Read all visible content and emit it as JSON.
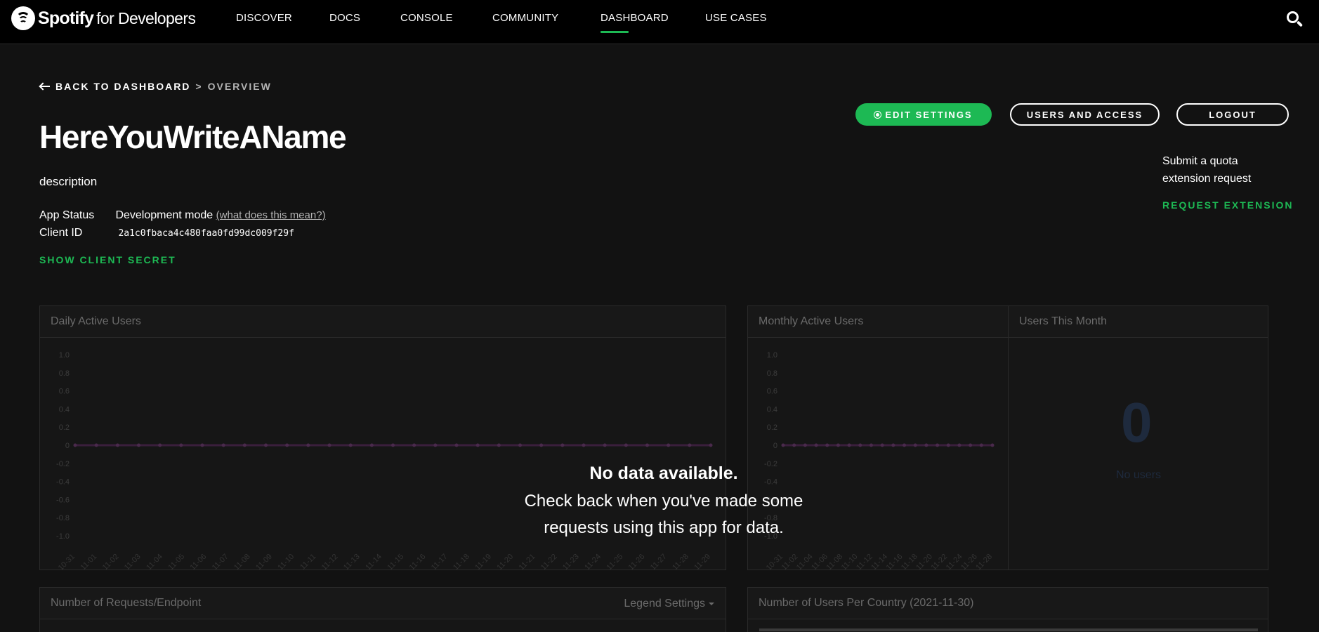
{
  "nav": {
    "brand_name": "Spotify",
    "brand_suffix": "for Developers",
    "links": [
      "DISCOVER",
      "DOCS",
      "CONSOLE",
      "COMMUNITY",
      "DASHBOARD",
      "USE CASES"
    ],
    "active": "DASHBOARD"
  },
  "breadcrumb": {
    "back": "BACK TO DASHBOARD",
    "separator": ">",
    "current": "OVERVIEW"
  },
  "app": {
    "name": "HereYouWriteAName",
    "description": "description",
    "status_label": "App Status",
    "status_value": "Development mode",
    "status_link": "(what does this mean?)",
    "client_id_label": "Client ID",
    "client_id": "2a1c0fbaca4c480faa0fd99dc009f29f",
    "show_secret": "SHOW CLIENT SECRET"
  },
  "actions": {
    "edit_settings": "EDIT SETTINGS",
    "users_access": "USERS AND ACCESS",
    "logout": "LOGOUT"
  },
  "quota": {
    "text": "Submit a quota extension request",
    "link": "REQUEST EXTENSION"
  },
  "panels": {
    "daily": "Daily Active Users",
    "monthly": "Monthly Active Users",
    "users_month": "Users This Month",
    "users_month_value": "0",
    "users_month_caption": "No users",
    "requests": "Number of Requests/Endpoint",
    "legend_settings": "Legend Settings",
    "country": "Number of Users Per Country (2021-11-30)"
  },
  "no_data": {
    "title": "No data available.",
    "message_line1": "Check back when you've made some",
    "message_line2": "requests using this app for data."
  },
  "colors": {
    "accent": "#1db954",
    "line": "#3a1f3c"
  },
  "chart_data": [
    {
      "type": "line",
      "series": [
        {
          "values": [
            0,
            0,
            0,
            0,
            0,
            0,
            0,
            0,
            0,
            0,
            0,
            0,
            0,
            0,
            0,
            0,
            0,
            0,
            0,
            0,
            0,
            0,
            0,
            0,
            0,
            0,
            0,
            0,
            0,
            0,
            0
          ]
        }
      ],
      "x": [
        "10-31",
        "11-01",
        "11-02",
        "11-03",
        "11-04",
        "11-05",
        "11-06",
        "11-07",
        "11-08",
        "11-09",
        "11-10",
        "11-11",
        "11-12",
        "11-13",
        "11-14",
        "11-15",
        "11-16",
        "11-17",
        "11-18",
        "11-19",
        "11-20",
        "11-21",
        "11-22",
        "11-23",
        "11-24",
        "11-25",
        "11-26",
        "11-27",
        "11-28",
        "11-29"
      ],
      "yticks": [
        "1.0",
        "0.8",
        "0.6",
        "0.4",
        "0.2",
        "0",
        "-0.2",
        "-0.4",
        "-0.6",
        "-0.8",
        "-1.0"
      ],
      "ylim": [
        -1,
        1
      ]
    },
    {
      "type": "line",
      "series": [
        {
          "values": [
            0,
            0,
            0,
            0,
            0,
            0,
            0,
            0,
            0,
            0,
            0,
            0,
            0,
            0,
            0,
            0,
            0,
            0,
            0,
            0
          ]
        }
      ],
      "x": [
        "10-31",
        "11-02",
        "11-04",
        "11-06",
        "11-08",
        "11-10",
        "11-12",
        "11-14",
        "11-16",
        "11-18",
        "11-20",
        "11-22",
        "11-24",
        "11-26",
        "11-28"
      ],
      "yticks": [
        "1.0",
        "0.8",
        "0.6",
        "0.4",
        "0.2",
        "0",
        "-0.2",
        "-0.4",
        "-0.6",
        "-0.8",
        "-1.0"
      ],
      "ylim": [
        -1,
        1
      ]
    }
  ]
}
